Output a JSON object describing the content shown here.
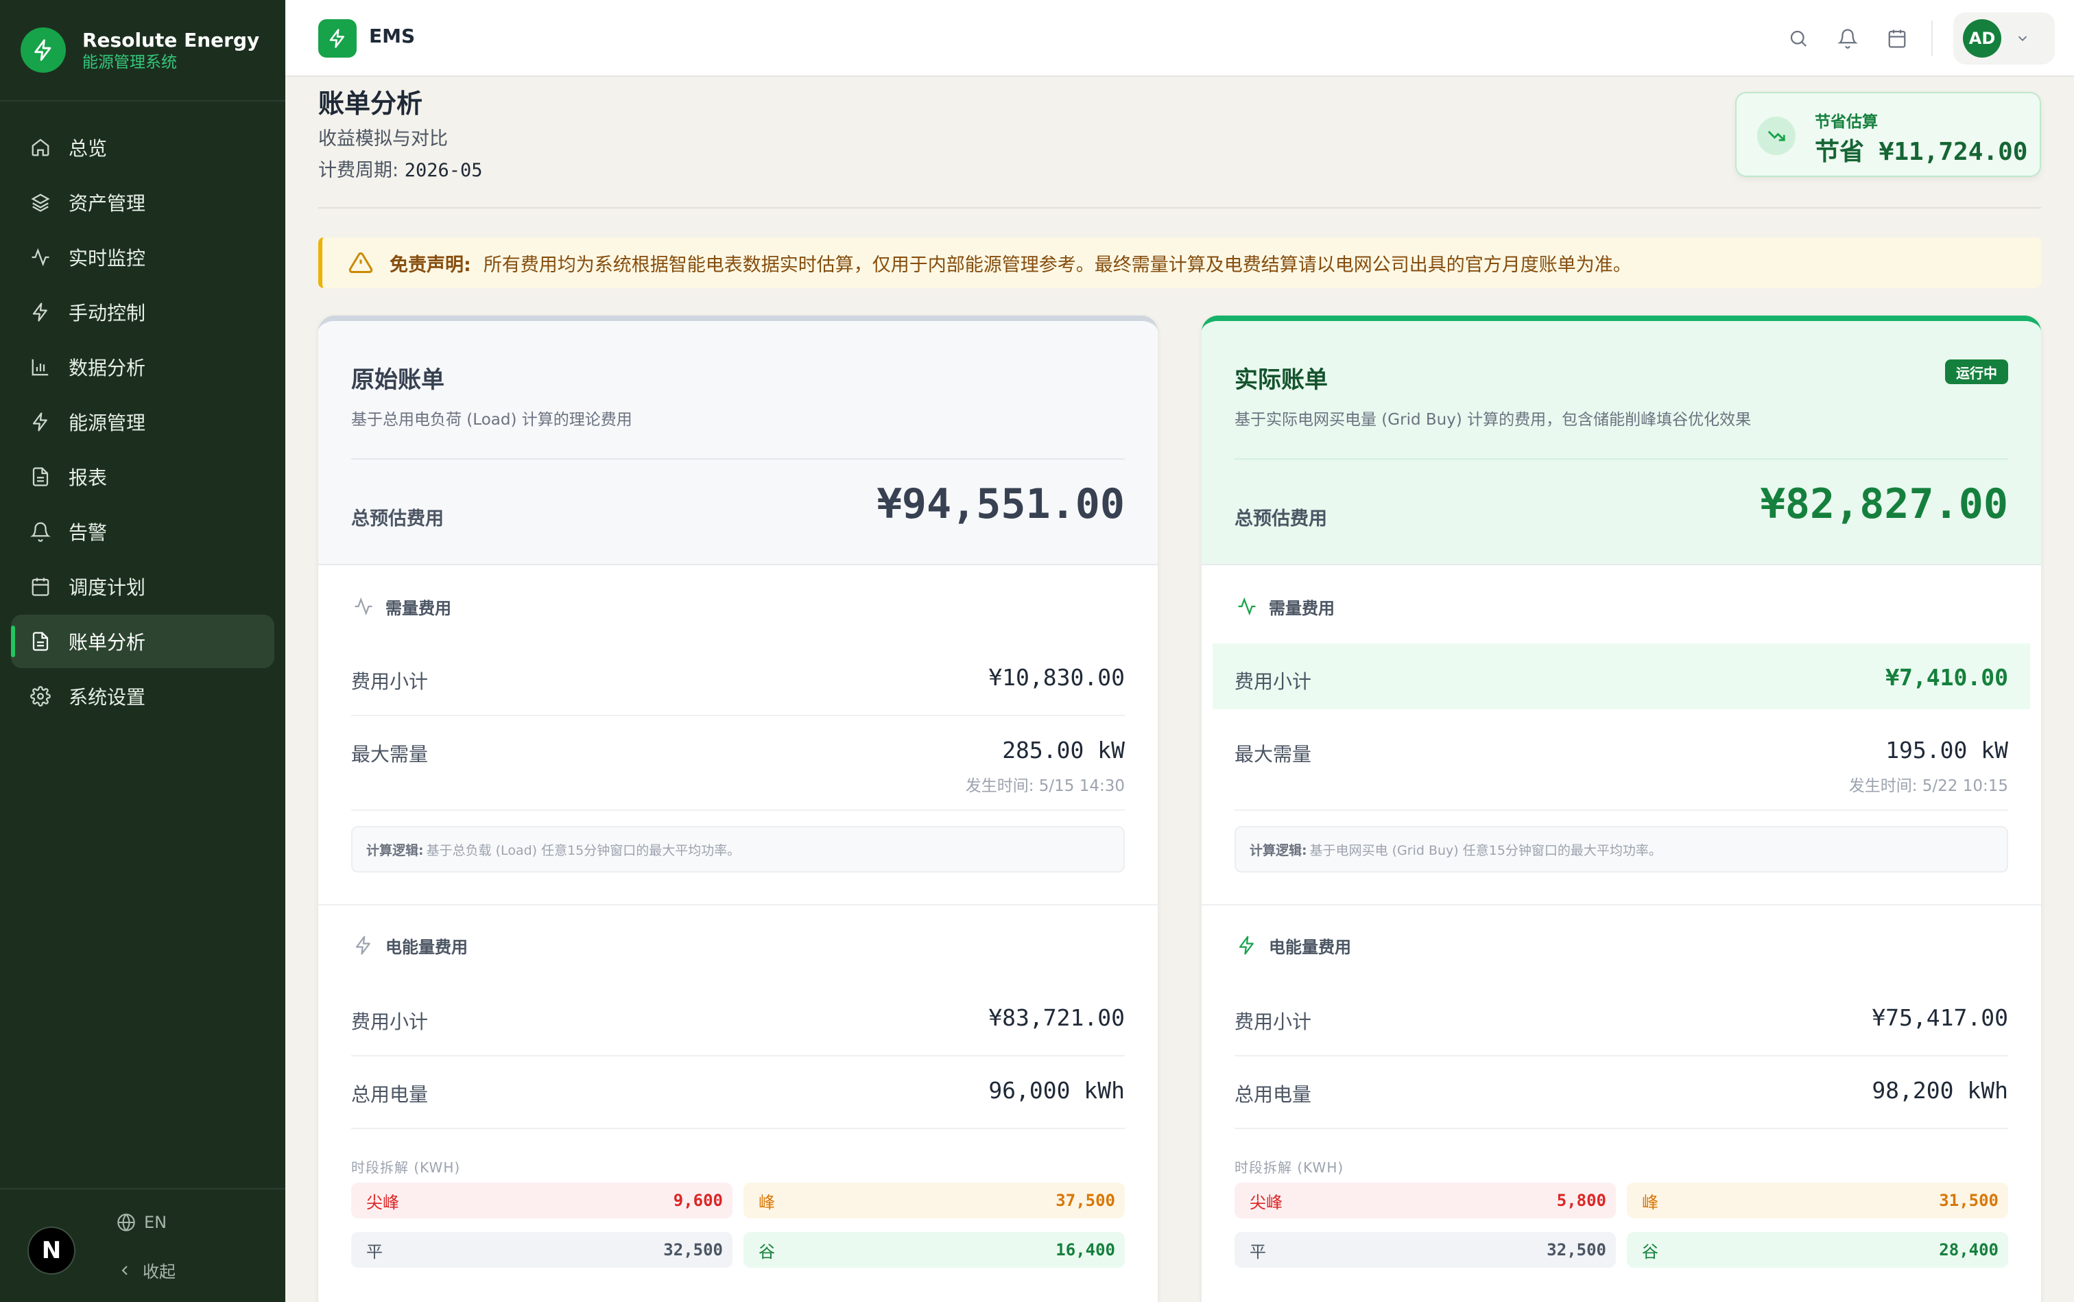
{
  "brand": {
    "name": "Resolute Energy",
    "subtitle": "能源管理系统"
  },
  "nav": {
    "items": [
      {
        "label": "总览",
        "icon": "home-icon"
      },
      {
        "label": "资产管理",
        "icon": "layers-icon"
      },
      {
        "label": "实时监控",
        "icon": "activity-icon"
      },
      {
        "label": "手动控制",
        "icon": "bolt-icon"
      },
      {
        "label": "数据分析",
        "icon": "bar-chart-icon"
      },
      {
        "label": "能源管理",
        "icon": "bolt-icon"
      },
      {
        "label": "报表",
        "icon": "document-icon"
      },
      {
        "label": "告警",
        "icon": "bell-icon"
      },
      {
        "label": "调度计划",
        "icon": "calendar-icon"
      },
      {
        "label": "账单分析",
        "icon": "document-icon",
        "active": true
      },
      {
        "label": "系统设置",
        "icon": "gear-icon"
      }
    ]
  },
  "footer": {
    "lang_label": "EN",
    "collapse_label": "收起",
    "avatar_letter": "N"
  },
  "header": {
    "title": "EMS",
    "user_initials": "AD"
  },
  "page": {
    "title": "账单分析",
    "subtitle": "收益模拟与对比",
    "period_label": "计费周期:",
    "period_value": "2026-05"
  },
  "savings": {
    "label": "节省估算",
    "value": "节省 ¥11,724.00"
  },
  "disclaimer": {
    "label": "免责声明:",
    "text": "所有费用均为系统根据智能电表数据实时估算，仅用于内部能源管理参考。最终需量计算及电费结算请以电网公司出具的官方月度账单为准。"
  },
  "original": {
    "title": "原始账单",
    "desc": "基于总用电负荷 (Load) 计算的理论费用",
    "total_label": "总预估费用",
    "total_value": "¥94,551.00",
    "demand": {
      "heading": "需量费用",
      "subtotal_label": "费用小计",
      "subtotal_value": "¥10,830.00",
      "max_label": "最大需量",
      "max_value": "285.00 kW",
      "max_time": "发生时间: 5/15 14:30",
      "logic_label": "计算逻辑:",
      "logic_text": "基于总负载 (Load) 任意15分钟窗口的最大平均功率。"
    },
    "energy": {
      "heading": "电能量费用",
      "subtotal_label": "费用小计",
      "subtotal_value": "¥83,721.00",
      "usage_label": "总用电量",
      "usage_value": "96,000 kWh",
      "tou_label": "时段拆解 (KWH)",
      "sharp_label": "尖峰",
      "sharp_value": "9,600",
      "peak_label": "峰",
      "peak_value": "37,500",
      "flat_label": "平",
      "flat_value": "32,500",
      "valley_label": "谷",
      "valley_value": "16,400"
    }
  },
  "actual": {
    "title": "实际账单",
    "badge": "运行中",
    "desc": "基于实际电网买电量 (Grid Buy) 计算的费用，包含储能削峰填谷优化效果",
    "total_label": "总预估费用",
    "total_value": "¥82,827.00",
    "demand": {
      "heading": "需量费用",
      "subtotal_label": "费用小计",
      "subtotal_value": "¥7,410.00",
      "max_label": "最大需量",
      "max_value": "195.00 kW",
      "max_time": "发生时间: 5/22 10:15",
      "logic_label": "计算逻辑:",
      "logic_text": "基于电网买电 (Grid Buy) 任意15分钟窗口的最大平均功率。"
    },
    "energy": {
      "heading": "电能量费用",
      "subtotal_label": "费用小计",
      "subtotal_value": "¥75,417.00",
      "usage_label": "总用电量",
      "usage_value": "98,200 kWh",
      "tou_label": "时段拆解 (KWH)",
      "sharp_label": "尖峰",
      "sharp_value": "5,800",
      "peak_label": "峰",
      "peak_value": "31,500",
      "flat_label": "平",
      "flat_value": "32,500",
      "valley_label": "谷",
      "valley_value": "28,400"
    }
  },
  "colors": {
    "sidebar": "#1c2f1f",
    "accent": "#17a34a",
    "savings_text": "#166534",
    "warning": "#eab308"
  }
}
